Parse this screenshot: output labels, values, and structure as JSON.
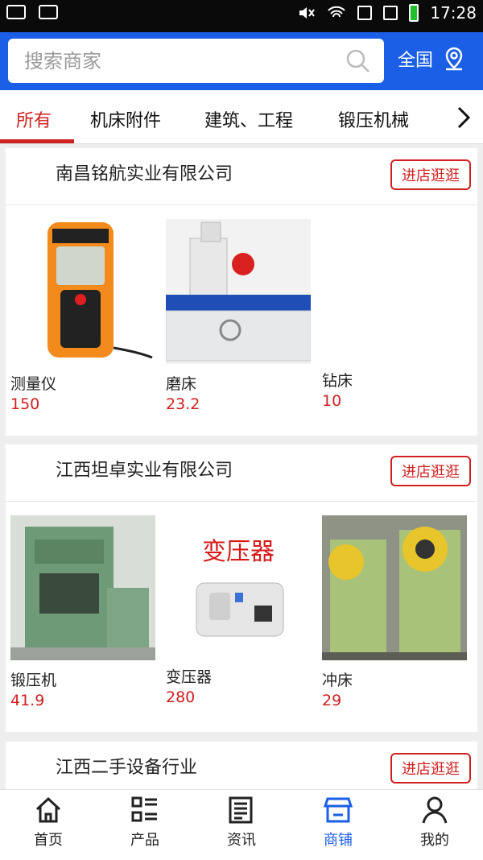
{
  "status_bar": {
    "time": "17:28"
  },
  "search": {
    "placeholder": "搜索商家"
  },
  "region": {
    "label": "全国"
  },
  "tabs": [
    {
      "label": "所有",
      "active": true
    },
    {
      "label": "机床附件",
      "active": false
    },
    {
      "label": "建筑、工程",
      "active": false
    },
    {
      "label": "锻压机械",
      "active": false
    }
  ],
  "stores": [
    {
      "name": "南昌铭航实业有限公司",
      "button": "进店逛逛",
      "products": [
        {
          "name": "测量仪",
          "price": "150",
          "icon": "laser-distance-meter"
        },
        {
          "name": "磨床",
          "price": "23.2",
          "icon": "grinding-machine"
        },
        {
          "name": "钻床",
          "price": "10",
          "icon": ""
        }
      ]
    },
    {
      "name": "江西坦卓实业有限公司",
      "button": "进店逛逛",
      "products": [
        {
          "name": "锻压机",
          "price": "41.9",
          "icon": "forging-press"
        },
        {
          "name": "变压器",
          "price": "280",
          "icon": "transformer",
          "image_text": "变压器"
        },
        {
          "name": "冲床",
          "price": "29",
          "icon": "punch-press"
        }
      ]
    },
    {
      "name": "江西二手设备行业",
      "button": "进店逛逛",
      "products": []
    }
  ],
  "bottom_nav": [
    {
      "label": "首页",
      "icon": "home-icon",
      "active": false
    },
    {
      "label": "产品",
      "icon": "product-list-icon",
      "active": false
    },
    {
      "label": "资讯",
      "icon": "news-icon",
      "active": false
    },
    {
      "label": "商铺",
      "icon": "store-icon",
      "active": true
    },
    {
      "label": "我的",
      "icon": "user-icon",
      "active": false
    }
  ],
  "colors": {
    "brand_blue": "#1b5fe6",
    "accent_red": "#d02020"
  }
}
